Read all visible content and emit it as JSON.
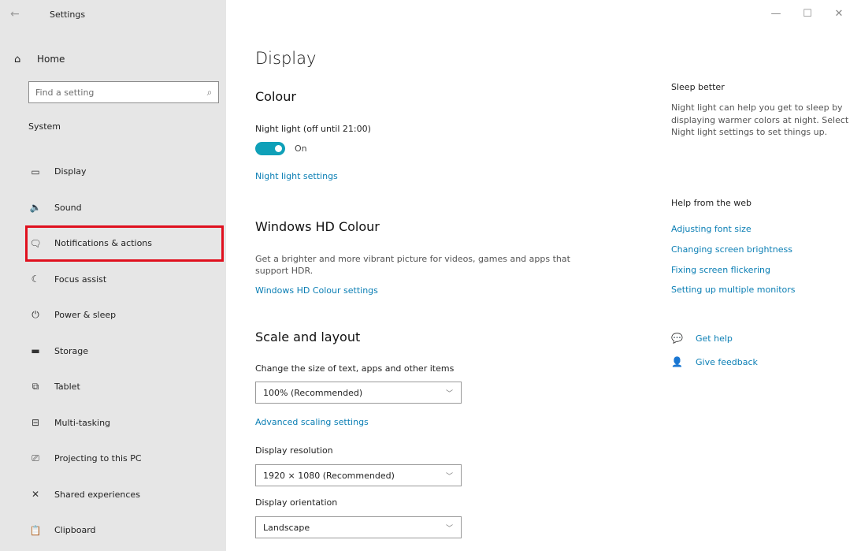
{
  "window": {
    "title": "Settings",
    "back_glyph": "←",
    "controls": {
      "minimize": "—",
      "maximize": "☐",
      "close": "✕"
    }
  },
  "sidebar": {
    "home": {
      "icon": "home-icon",
      "glyph": "⌂",
      "label": "Home"
    },
    "search": {
      "placeholder": "Find a setting",
      "icon": "search-icon",
      "glyph": "⌕"
    },
    "section": "System",
    "items": [
      {
        "icon": "display-icon",
        "glyph": "▭",
        "label": "Display"
      },
      {
        "icon": "sound-icon",
        "glyph": "🔈",
        "label": "Sound"
      },
      {
        "icon": "notifications-icon",
        "glyph": "🗨",
        "label": "Notifications & actions",
        "highlighted": true
      },
      {
        "icon": "focus-assist-icon",
        "glyph": "☾",
        "label": "Focus assist"
      },
      {
        "icon": "power-icon",
        "glyph": "⏻",
        "label": "Power & sleep"
      },
      {
        "icon": "storage-icon",
        "glyph": "▬",
        "label": "Storage"
      },
      {
        "icon": "tablet-icon",
        "glyph": "⧉",
        "label": "Tablet"
      },
      {
        "icon": "multitasking-icon",
        "glyph": "⊟",
        "label": "Multi-tasking"
      },
      {
        "icon": "projecting-icon",
        "glyph": "⎚",
        "label": "Projecting to this PC"
      },
      {
        "icon": "shared-experiences-icon",
        "glyph": "✕",
        "label": "Shared experiences"
      },
      {
        "icon": "clipboard-icon",
        "glyph": "📋",
        "label": "Clipboard"
      }
    ]
  },
  "main": {
    "title": "Display",
    "colour": {
      "heading": "Colour",
      "night_light_label": "Night light (off until 21:00)",
      "toggle_state": "On",
      "settings_link": "Night light settings"
    },
    "hd_colour": {
      "heading": "Windows HD Colour",
      "description": "Get a brighter and more vibrant picture for videos, games and apps that support HDR.",
      "settings_link": "Windows HD Colour settings"
    },
    "scale": {
      "heading": "Scale and layout",
      "size_label": "Change the size of text, apps and other items",
      "size_value": "100% (Recommended)",
      "advanced_link": "Advanced scaling settings",
      "resolution_label": "Display resolution",
      "resolution_value": "1920 × 1080 (Recommended)",
      "orientation_label": "Display orientation",
      "orientation_value": "Landscape"
    }
  },
  "side_panel": {
    "sleep_title": "Sleep better",
    "sleep_text": "Night light can help you get to sleep by displaying warmer colors at night. Select Night light settings to set things up.",
    "help_title": "Help from the web",
    "links": [
      "Adjusting font size",
      "Changing screen brightness",
      "Fixing screen flickering",
      "Setting up multiple monitors"
    ],
    "get_help": {
      "icon": "get-help-icon",
      "glyph": "💬",
      "label": "Get help"
    },
    "feedback": {
      "icon": "feedback-icon",
      "glyph": "👤",
      "label": "Give feedback"
    }
  },
  "colors": {
    "accent": "#0fa0b8",
    "link": "#0a7eb4",
    "sidebar_bg": "#e6e6e6",
    "highlight_box": "#e0101e"
  }
}
